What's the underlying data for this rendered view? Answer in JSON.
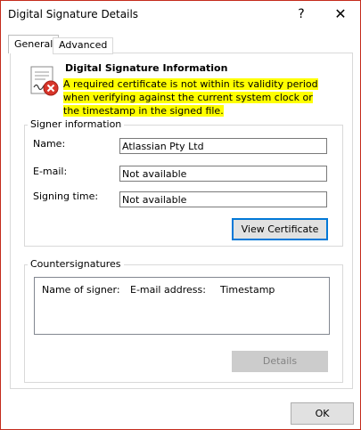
{
  "window": {
    "title": "Digital Signature Details",
    "help_glyph": "?",
    "close_glyph": "✕"
  },
  "tabs": [
    {
      "label": "General"
    },
    {
      "label": "Advanced"
    }
  ],
  "info": {
    "title": "Digital Signature Information",
    "warning": "A required certificate is not within its validity period when verifying against the current system clock or the timestamp in the signed file."
  },
  "signer": {
    "group_label": "Signer information",
    "name_label": "Name:",
    "name_value": "Atlassian Pty Ltd",
    "email_label": "E-mail:",
    "email_value": "Not available",
    "time_label": "Signing time:",
    "time_value": "Not available",
    "view_cert_label": "View Certificate"
  },
  "countersignatures": {
    "group_label": "Countersignatures",
    "columns": [
      "Name of signer:",
      "E-mail address:",
      "Timestamp"
    ],
    "details_label": "Details"
  },
  "ok_label": "OK",
  "colors": {
    "highlight": "#ffff00",
    "focus_border": "#0078d7",
    "window_border": "#c42b1c"
  },
  "icons": [
    "signature-warning-icon",
    "help-icon",
    "close-icon"
  ]
}
